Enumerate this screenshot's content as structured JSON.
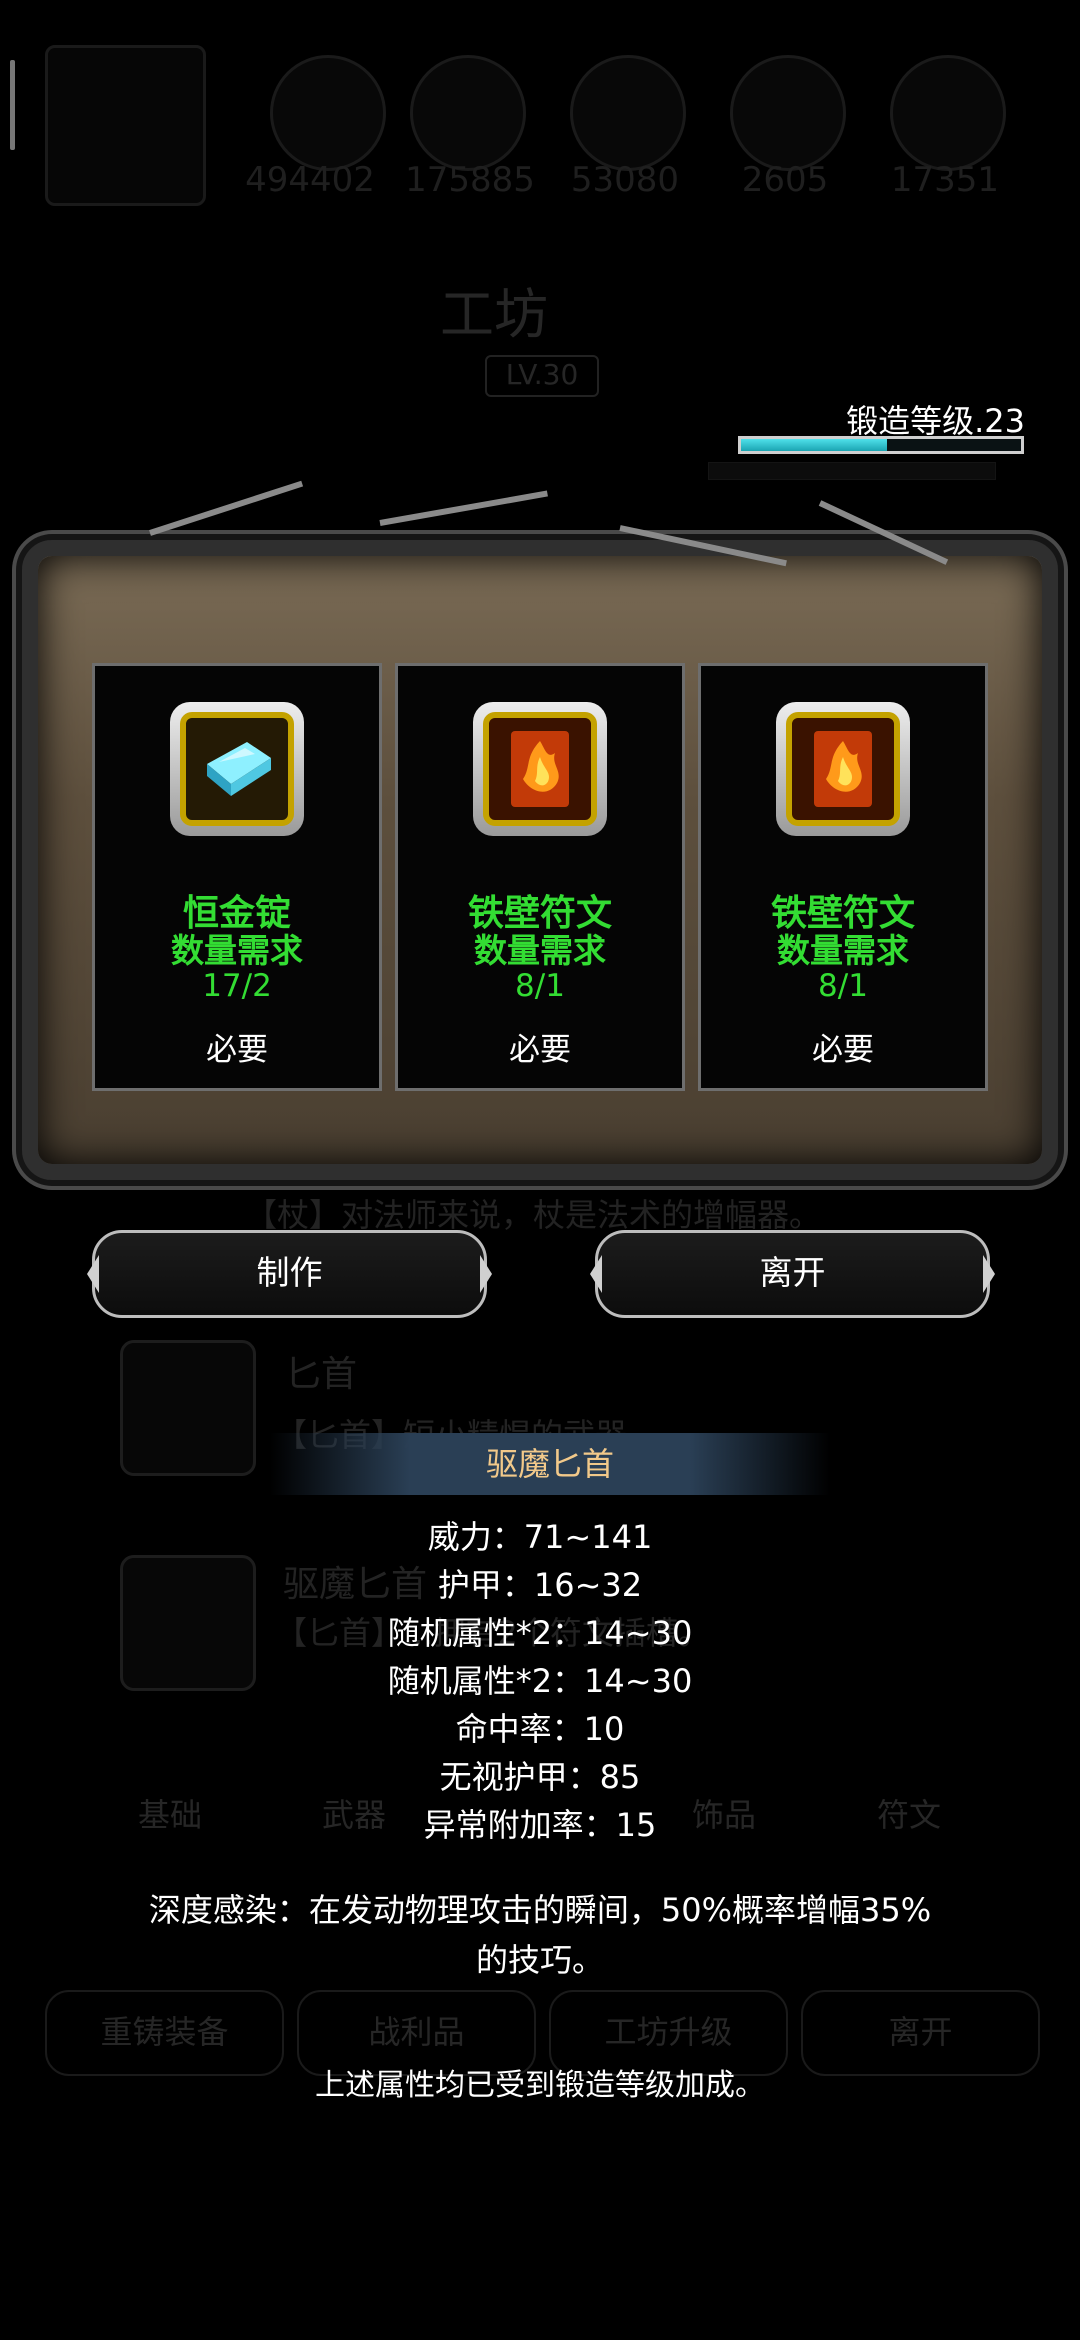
{
  "top_stats": [
    "494402",
    "175885",
    "53080",
    "2605",
    "17351"
  ],
  "workshop": {
    "title": "工坊",
    "level": "LV.30"
  },
  "forge": {
    "label": "锻造等级.23",
    "progress": 0.52
  },
  "materials": [
    {
      "name": "恒金锭",
      "qty_label": "数量需求",
      "qty": "17/2",
      "required": "必要",
      "icon": "ingot-icon"
    },
    {
      "name": "铁壁符文",
      "qty_label": "数量需求",
      "qty": "8/1",
      "required": "必要",
      "icon": "rune-icon"
    },
    {
      "name": "铁壁符文",
      "qty_label": "数量需求",
      "qty": "8/1",
      "required": "必要",
      "icon": "rune-icon"
    }
  ],
  "actions": {
    "craft": "制作",
    "leave": "离开"
  },
  "background": {
    "staff_desc": "【杖】对法师来说，杖是法术的增幅器。",
    "dagger_title": "匕首",
    "dagger_desc": "【匕首】短小精悍的武器",
    "exorcism_title": "驱魔匕首",
    "exorcism_desc": "【匕首】...拥有2个符文插槽。",
    "tabs": [
      "基础",
      "武器",
      "饰品",
      "符文"
    ],
    "bottom_buttons": [
      "重铸装备",
      "战利品",
      "工坊升级",
      "离开"
    ]
  },
  "tooltip": {
    "title": "驱魔匕首",
    "stats": [
      "威力：71~141",
      "护甲：16~32",
      "随机属性*2：14~30",
      "随机属性*2：14~30",
      "命中率：10",
      "无视护甲：85",
      "异常附加率：15"
    ],
    "effect": "深度感染：在发动物理攻击的瞬间，50%概率增幅35%的技巧。",
    "note": "上述属性均已受到锻造等级加成。"
  }
}
